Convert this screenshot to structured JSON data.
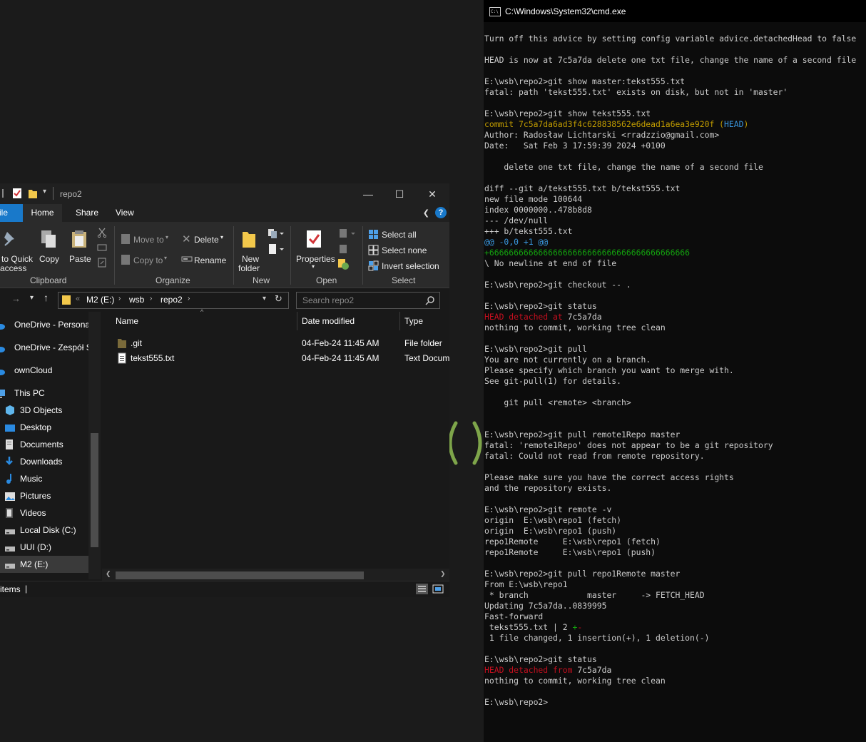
{
  "explorer": {
    "title": "repo2",
    "tabs": {
      "file": "ile",
      "home": "Home",
      "share": "Share",
      "view": "View"
    },
    "ribbon": {
      "pin_line1": "to Quick",
      "pin_line2": "access",
      "copy": "Copy",
      "paste": "Paste",
      "clipboard": "Clipboard",
      "move_to": "Move to",
      "copy_to": "Copy to",
      "delete": "Delete",
      "rename": "Rename",
      "organize": "Organize",
      "new_folder_line1": "New",
      "new_folder_line2": "folder",
      "new": "New",
      "properties": "Properties",
      "open": "Open",
      "select_all": "Select all",
      "select_none": "Select none",
      "invert_selection": "Invert selection",
      "select": "Select"
    },
    "address": {
      "prefix": "«",
      "crumbs": [
        "M2 (E:)",
        "wsb",
        "repo2"
      ]
    },
    "search_placeholder": "Search repo2",
    "nav": [
      {
        "label": "OneDrive - Personal",
        "icon": "cloud-icon"
      },
      {
        "label": "OneDrive - Zespół S",
        "icon": "cloud-icon"
      },
      {
        "label": "ownCloud",
        "icon": "cloud-icon"
      },
      {
        "label": "This PC",
        "icon": "computer-icon"
      },
      {
        "label": "3D Objects",
        "icon": "cube-icon"
      },
      {
        "label": "Desktop",
        "icon": "desktop-icon"
      },
      {
        "label": "Documents",
        "icon": "document-icon"
      },
      {
        "label": "Downloads",
        "icon": "download-icon"
      },
      {
        "label": "Music",
        "icon": "music-icon"
      },
      {
        "label": "Pictures",
        "icon": "picture-icon"
      },
      {
        "label": "Videos",
        "icon": "video-icon"
      },
      {
        "label": "Local Disk (C:)",
        "icon": "drive-icon"
      },
      {
        "label": "UUI (D:)",
        "icon": "drive-icon"
      },
      {
        "label": "M2 (E:)",
        "icon": "drive-icon"
      }
    ],
    "columns": {
      "name": "Name",
      "date": "Date modified",
      "type": "Type"
    },
    "files": [
      {
        "name": ".git",
        "date": "04-Feb-24 11:45 AM",
        "type": "File folder",
        "icon": "folder-icon"
      },
      {
        "name": "tekst555.txt",
        "date": "04-Feb-24 11:45 AM",
        "type": "Text Docum",
        "icon": "text-file-icon"
      }
    ],
    "status": "items",
    "status_sep": "|"
  },
  "cmd": {
    "title": "C:\\Windows\\System32\\cmd.exe",
    "icon_text": "C:\\",
    "lines": [
      [
        {
          "t": "Turn off this advice by setting config variable advice.detachedHead to false"
        }
      ],
      [
        {
          "t": ""
        }
      ],
      [
        {
          "t": "HEAD is now at 7c5a7da delete one txt file, change the name of a second file"
        }
      ],
      [
        {
          "t": ""
        }
      ],
      [
        {
          "t": "E:\\wsb\\repo2>git show master:tekst555.txt"
        }
      ],
      [
        {
          "t": "fatal: path 'tekst555.txt' exists on disk, but not in 'master'"
        }
      ],
      [
        {
          "t": ""
        }
      ],
      [
        {
          "t": "E:\\wsb\\repo2>git show tekst555.txt"
        }
      ],
      [
        {
          "t": "commit 7c5a7da6ad3f4c628838562e6dead1a6ea3e920f (",
          "c": "yel"
        },
        {
          "t": "HEAD",
          "c": "cyan"
        },
        {
          "t": ")",
          "c": "yel"
        }
      ],
      [
        {
          "t": "Author: Radosław Lichtarski <rradzzio@gmail.com>"
        }
      ],
      [
        {
          "t": "Date:   Sat Feb 3 17:59:39 2024 +0100"
        }
      ],
      [
        {
          "t": ""
        }
      ],
      [
        {
          "t": "    delete one txt file, change the name of a second file"
        }
      ],
      [
        {
          "t": ""
        }
      ],
      [
        {
          "t": "diff --git a/tekst555.txt b/tekst555.txt"
        }
      ],
      [
        {
          "t": "new file mode 100644"
        }
      ],
      [
        {
          "t": "index 0000000..478b8d8"
        }
      ],
      [
        {
          "t": "--- /dev/null"
        }
      ],
      [
        {
          "t": "+++ b/tekst555.txt"
        }
      ],
      [
        {
          "t": "@@ -0,0 +1 @@",
          "c": "cyan"
        }
      ],
      [
        {
          "t": "+66666666666666666666666666666666666666666",
          "c": "grn"
        }
      ],
      [
        {
          "t": "\\ No newline at end of file"
        }
      ],
      [
        {
          "t": ""
        }
      ],
      [
        {
          "t": "E:\\wsb\\repo2>git checkout -- ."
        }
      ],
      [
        {
          "t": ""
        }
      ],
      [
        {
          "t": "E:\\wsb\\repo2>git status"
        }
      ],
      [
        {
          "t": "HEAD detached at ",
          "c": "red"
        },
        {
          "t": "7c5a7da"
        }
      ],
      [
        {
          "t": "nothing to commit, working tree clean"
        }
      ],
      [
        {
          "t": ""
        }
      ],
      [
        {
          "t": "E:\\wsb\\repo2>git pull"
        }
      ],
      [
        {
          "t": "You are not currently on a branch."
        }
      ],
      [
        {
          "t": "Please specify which branch you want to merge with."
        }
      ],
      [
        {
          "t": "See git-pull(1) for details."
        }
      ],
      [
        {
          "t": ""
        }
      ],
      [
        {
          "t": "    git pull <remote> <branch>"
        }
      ],
      [
        {
          "t": ""
        }
      ],
      [
        {
          "t": ""
        }
      ],
      [
        {
          "t": "E:\\wsb\\repo2>git pull remote1Repo master"
        }
      ],
      [
        {
          "t": "fatal: 'remote1Repo' does not appear to be a git repository"
        }
      ],
      [
        {
          "t": "fatal: Could not read from remote repository."
        }
      ],
      [
        {
          "t": ""
        }
      ],
      [
        {
          "t": "Please make sure you have the correct access rights"
        }
      ],
      [
        {
          "t": "and the repository exists."
        }
      ],
      [
        {
          "t": ""
        }
      ],
      [
        {
          "t": "E:\\wsb\\repo2>git remote -v"
        }
      ],
      [
        {
          "t": "origin  E:\\wsb\\repo1 (fetch)"
        }
      ],
      [
        {
          "t": "origin  E:\\wsb\\repo1 (push)"
        }
      ],
      [
        {
          "t": "repo1Remote     E:\\wsb\\repo1 (fetch)"
        }
      ],
      [
        {
          "t": "repo1Remote     E:\\wsb\\repo1 (push)"
        }
      ],
      [
        {
          "t": ""
        }
      ],
      [
        {
          "t": "E:\\wsb\\repo2>git pull repo1Remote master"
        }
      ],
      [
        {
          "t": "From E:\\wsb\\repo1"
        }
      ],
      [
        {
          "t": " * branch            master     -> FETCH_HEAD"
        }
      ],
      [
        {
          "t": "Updating 7c5a7da..0839995"
        }
      ],
      [
        {
          "t": "Fast-forward"
        }
      ],
      [
        {
          "t": " tekst555.txt | 2 "
        },
        {
          "t": "+",
          "c": "grn"
        },
        {
          "t": "-",
          "c": "red"
        }
      ],
      [
        {
          "t": " 1 file changed, 1 insertion(+), 1 deletion(-)"
        }
      ],
      [
        {
          "t": ""
        }
      ],
      [
        {
          "t": "E:\\wsb\\repo2>git status"
        }
      ],
      [
        {
          "t": "HEAD detached from ",
          "c": "red"
        },
        {
          "t": "7c5a7da"
        }
      ],
      [
        {
          "t": "nothing to commit, working tree clean"
        }
      ],
      [
        {
          "t": ""
        }
      ],
      [
        {
          "t": "E:\\wsb\\repo2>"
        }
      ]
    ]
  }
}
